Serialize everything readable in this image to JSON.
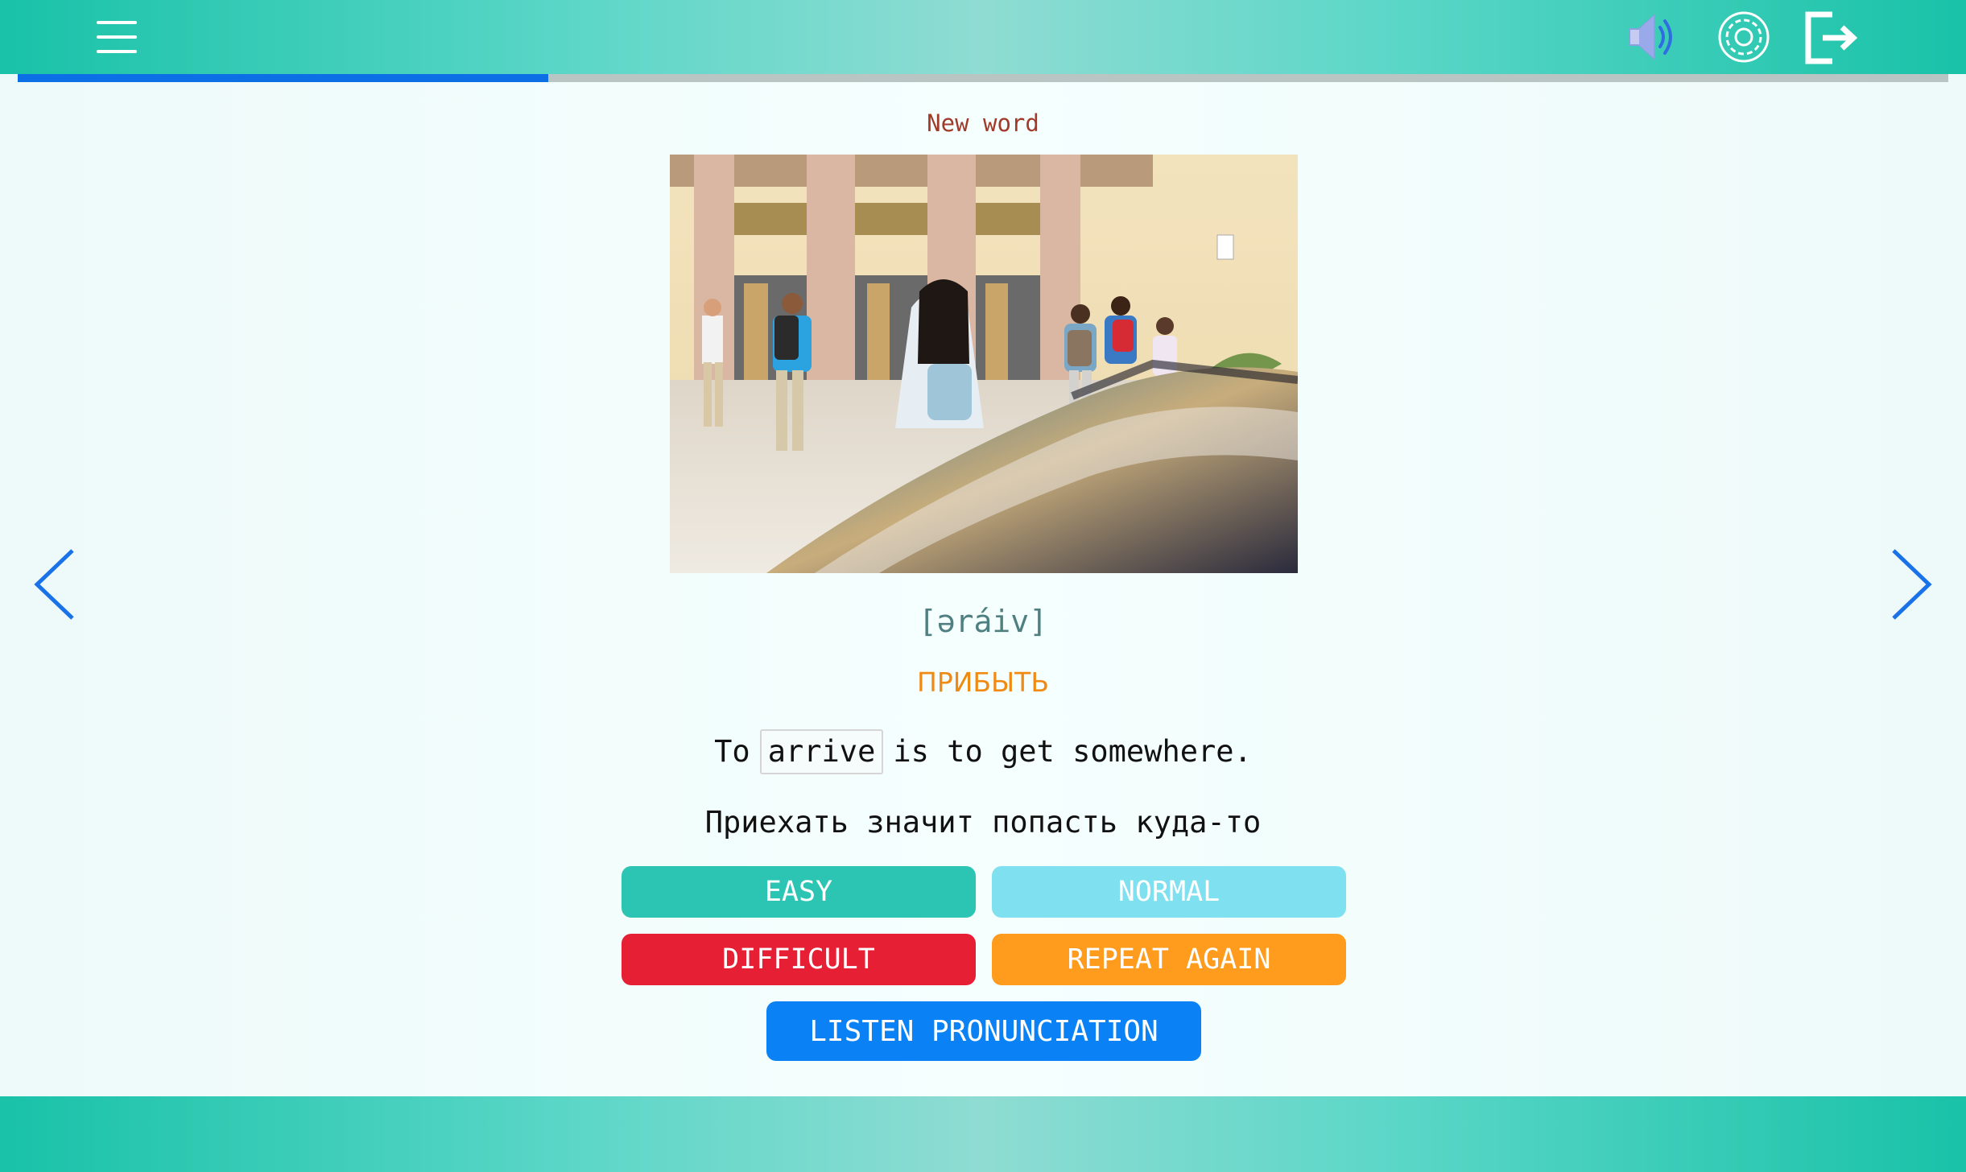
{
  "header": {
    "menu_icon": "hamburger-menu-icon",
    "sound_icon": "speaker-icon",
    "settings_icon": "gear-icon",
    "exit_icon": "logout-icon"
  },
  "progress": {
    "value": 0.275
  },
  "card": {
    "label": "New word",
    "transcription": "[əráiv]",
    "translation": "ПРИБЫТЬ",
    "sentence_before": "To",
    "sentence_word": "arrive",
    "sentence_after": "is to get somewhere.",
    "sentence_translation": "Приехать значит попасть куда-то"
  },
  "buttons": {
    "easy": "EASY",
    "normal": "NORMAL",
    "difficult": "DIFFICULT",
    "repeat": "REPEAT AGAIN",
    "listen": "LISTEN PRONUNCIATION"
  },
  "colors": {
    "header": "#19c2a8",
    "progress_fill": "#0d6fe6",
    "easy": "#2cc5b4",
    "normal": "#7fe0ef",
    "difficult": "#e71f35",
    "repeat": "#ff9c1d",
    "listen": "#0a82f5"
  }
}
